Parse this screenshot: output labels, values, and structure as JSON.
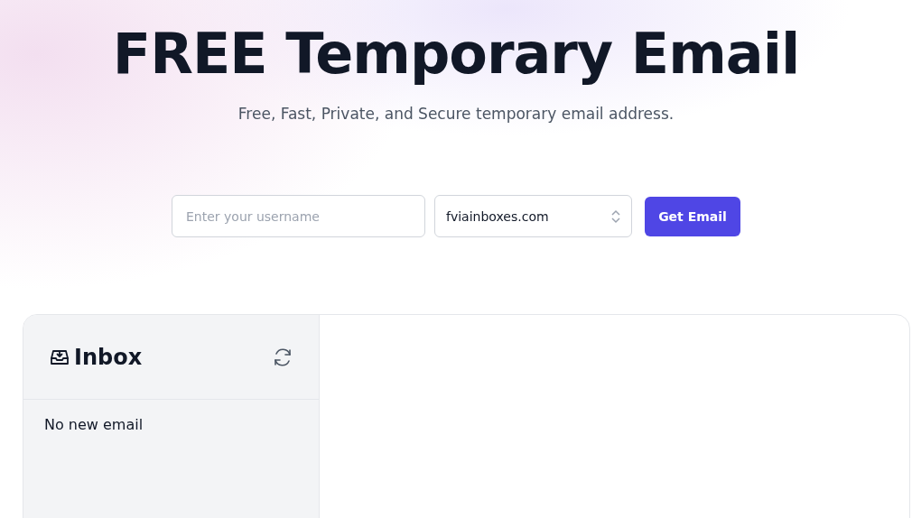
{
  "hero": {
    "title": "FREE Temporary Email",
    "subtitle": "Free, Fast, Private, and Secure temporary email address."
  },
  "form": {
    "username": {
      "placeholder": "Enter your username"
    },
    "domain": {
      "value": "fviainboxes.com"
    },
    "button": "Get Email"
  },
  "inbox": {
    "title": "Inbox",
    "empty_text": "No new email"
  }
}
